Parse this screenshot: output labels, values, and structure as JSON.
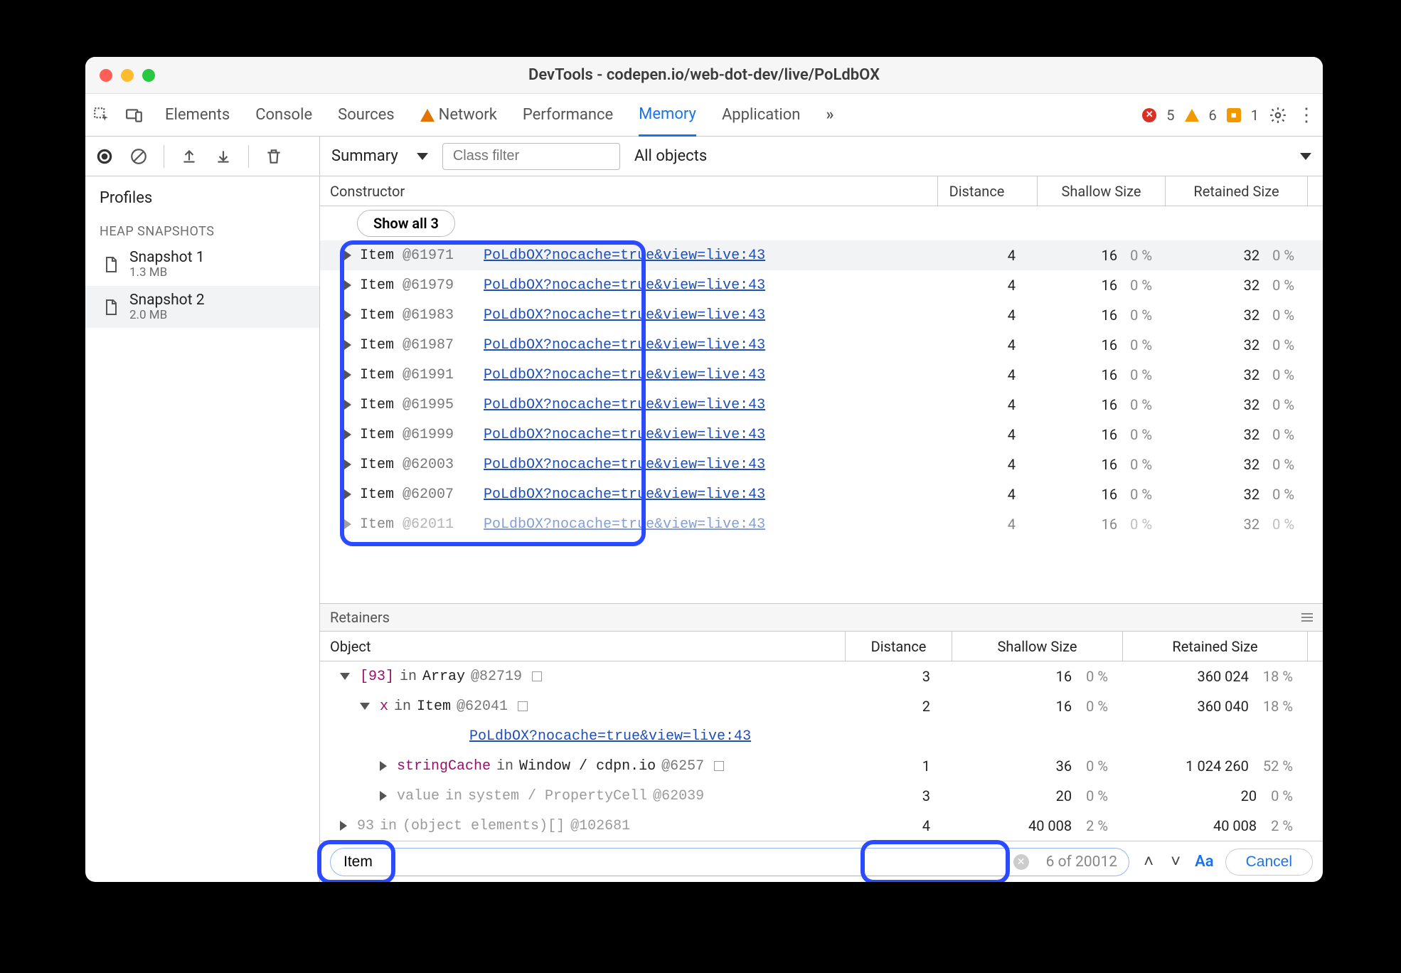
{
  "window_title": "DevTools - codepen.io/web-dot-dev/live/PoLdbOX",
  "tabs": {
    "elements": "Elements",
    "console": "Console",
    "sources": "Sources",
    "network": "Network",
    "performance": "Performance",
    "memory": "Memory",
    "application": "Application"
  },
  "tab_errors": {
    "errors": "5",
    "warnings": "6",
    "issues": "1"
  },
  "sidebar": {
    "profiles_header": "Profiles",
    "section": "HEAP SNAPSHOTS",
    "snapshots": [
      {
        "name": "Snapshot 1",
        "size": "1.3 MB"
      },
      {
        "name": "Snapshot 2",
        "size": "2.0 MB"
      }
    ]
  },
  "toolbar": {
    "view": "Summary",
    "class_filter_placeholder": "Class filter",
    "all_objects": "All objects"
  },
  "grid": {
    "headers": {
      "constructor": "Constructor",
      "distance": "Distance",
      "shallow": "Shallow Size",
      "retained": "Retained Size"
    },
    "show_all": "Show all 3",
    "source_link": "PoLdbOX?nocache=true&view=live:43",
    "rows": [
      {
        "name": "Item",
        "id": "@61971",
        "distance": "4",
        "shallow": "16",
        "shallow_pct": "0 %",
        "retained": "32",
        "retained_pct": "0 %",
        "selected": true
      },
      {
        "name": "Item",
        "id": "@61979",
        "distance": "4",
        "shallow": "16",
        "shallow_pct": "0 %",
        "retained": "32",
        "retained_pct": "0 %"
      },
      {
        "name": "Item",
        "id": "@61983",
        "distance": "4",
        "shallow": "16",
        "shallow_pct": "0 %",
        "retained": "32",
        "retained_pct": "0 %"
      },
      {
        "name": "Item",
        "id": "@61987",
        "distance": "4",
        "shallow": "16",
        "shallow_pct": "0 %",
        "retained": "32",
        "retained_pct": "0 %"
      },
      {
        "name": "Item",
        "id": "@61991",
        "distance": "4",
        "shallow": "16",
        "shallow_pct": "0 %",
        "retained": "32",
        "retained_pct": "0 %"
      },
      {
        "name": "Item",
        "id": "@61995",
        "distance": "4",
        "shallow": "16",
        "shallow_pct": "0 %",
        "retained": "32",
        "retained_pct": "0 %"
      },
      {
        "name": "Item",
        "id": "@61999",
        "distance": "4",
        "shallow": "16",
        "shallow_pct": "0 %",
        "retained": "32",
        "retained_pct": "0 %"
      },
      {
        "name": "Item",
        "id": "@62003",
        "distance": "4",
        "shallow": "16",
        "shallow_pct": "0 %",
        "retained": "32",
        "retained_pct": "0 %"
      },
      {
        "name": "Item",
        "id": "@62007",
        "distance": "4",
        "shallow": "16",
        "shallow_pct": "0 %",
        "retained": "32",
        "retained_pct": "0 %"
      },
      {
        "name": "Item",
        "id": "@62011",
        "distance": "4",
        "shallow": "16",
        "shallow_pct": "0 %",
        "retained": "32",
        "retained_pct": "0 %"
      }
    ]
  },
  "retainers": {
    "title": "Retainers",
    "headers": {
      "object": "Object",
      "distance": "Distance",
      "shallow": "Shallow Size",
      "retained": "Retained Size"
    },
    "source_link": "PoLdbOX?nocache=true&view=live:43",
    "rows": [
      {
        "indent": 1,
        "arrow": "down",
        "prefix": "[93]",
        "mid": "in",
        "text": "Array",
        "id": "@82719",
        "sq": true,
        "distance": "3",
        "shallow": "16",
        "shallow_pct": "0 %",
        "retained": "360 024",
        "retained_pct": "18 %"
      },
      {
        "indent": 2,
        "arrow": "down",
        "prefix": "x",
        "mid": "in",
        "text": "Item",
        "id": "@62041",
        "sq": true,
        "distance": "2",
        "shallow": "16",
        "shallow_pct": "0 %",
        "retained": "360 040",
        "retained_pct": "18 %"
      },
      {
        "indent": 3,
        "arrow": "right",
        "prop": "stringCache",
        "mid": "in",
        "text": "Window / cdpn.io",
        "id": "@6257",
        "sq": true,
        "distance": "1",
        "shallow": "36",
        "shallow_pct": "0 %",
        "retained": "1 024 260",
        "retained_pct": "52 %"
      },
      {
        "indent": 3,
        "arrow": "right",
        "gray": true,
        "prop": "value",
        "mid": "in",
        "text": "system / PropertyCell",
        "id": "@62039",
        "distance": "3",
        "shallow": "20",
        "shallow_pct": "0 %",
        "retained": "20",
        "retained_pct": "0 %"
      },
      {
        "indent": 1,
        "arrow": "right",
        "gray": true,
        "prefix": "93",
        "mid": "in",
        "text": "(object elements)[]",
        "id": "@102681",
        "distance": "4",
        "shallow": "40 008",
        "shallow_pct": "2 %",
        "retained": "40 008",
        "retained_pct": "2 %"
      }
    ]
  },
  "search": {
    "value": "Item",
    "match": "6 of 20012",
    "aa": "Aa",
    "cancel": "Cancel"
  }
}
